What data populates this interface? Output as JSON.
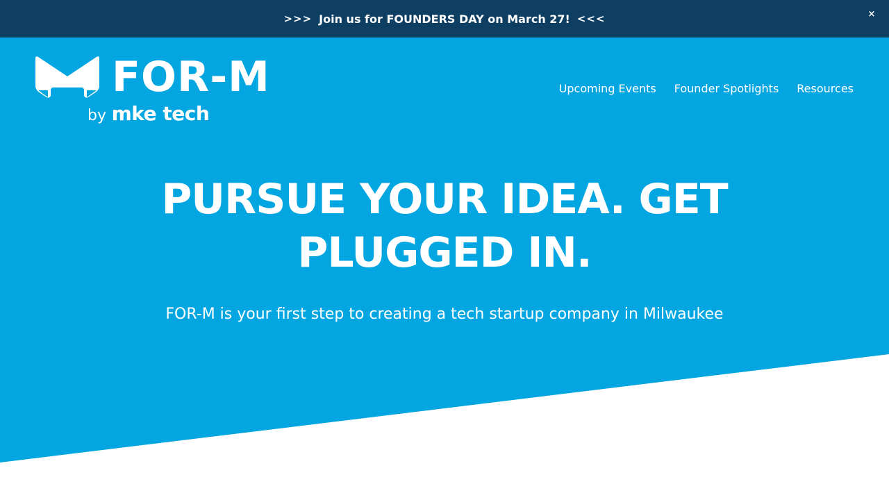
{
  "announcement": {
    "arrows_left": ">>>",
    "message": "Join us for FOUNDERS DAY on March 27!",
    "arrows_right": "<<<",
    "close_symbol": "×"
  },
  "brand": {
    "wordmark": "FOR-M",
    "by": "by",
    "parent": "mke tech",
    "logo_icon": "m-shield-logo-icon"
  },
  "nav": {
    "items": [
      {
        "label": "Upcoming Events"
      },
      {
        "label": "Founder Spotlights"
      },
      {
        "label": "Resources"
      }
    ]
  },
  "hero": {
    "headline_line1": "PURSUE YOUR IDEA. GET",
    "headline_line2": "PLUGGED IN.",
    "subheadline": "FOR-M is your first step to creating a tech startup company in Milwaukee"
  },
  "colors": {
    "announcement_bg": "#0f3e63",
    "hero_bg": "#03a6e0",
    "page_bg": "#ffffff",
    "text": "#ffffff"
  }
}
